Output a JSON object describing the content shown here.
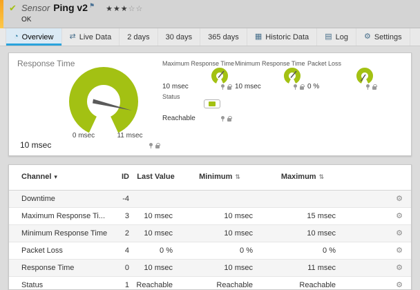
{
  "colors": {
    "accent": "#a3c113",
    "tab_underline": "#2aa3dc",
    "stripe_top": "#f6a320",
    "stripe_bottom": "#fdc84a"
  },
  "header": {
    "check_glyph": "✔",
    "type_label": "Sensor",
    "title": "Ping v2",
    "flag_glyph": "⚑",
    "stars_filled": "★★★",
    "stars_empty": "☆☆",
    "status": "OK"
  },
  "tabs": [
    {
      "label": "Overview",
      "icon": "◔"
    },
    {
      "label": "Live Data",
      "icon": "⇄"
    },
    {
      "label": "2 days"
    },
    {
      "label": "30 days"
    },
    {
      "label": "365 days"
    },
    {
      "label": "Historic Data",
      "icon": "▦"
    },
    {
      "label": "Log",
      "icon": "▤"
    },
    {
      "label": "Settings",
      "icon": "⚙"
    }
  ],
  "gauges": {
    "title": "Response Time",
    "main": {
      "value": "10 msec",
      "min_label": "0 msec",
      "max_label": "11 msec"
    },
    "minis": [
      {
        "title": "Maximum Response Time",
        "value": "10 msec"
      },
      {
        "title": "Minimum Response Time",
        "value": "10 msec"
      },
      {
        "title": "Packet Loss",
        "value": "0 %"
      }
    ],
    "status": {
      "title": "Status",
      "value": "Reachable"
    }
  },
  "table": {
    "columns": [
      "Channel",
      "ID",
      "Last Value",
      "Minimum",
      "Maximum"
    ],
    "sort_caret": "▾",
    "sort_glyph": "⇅",
    "settings_glyph": "⚙",
    "rows": [
      {
        "channel": "Downtime",
        "id": "-4",
        "last": "",
        "min": "",
        "max": ""
      },
      {
        "channel": "Maximum Response Ti...",
        "id": "3",
        "last": "10 msec",
        "min": "10 msec",
        "max": "15 msec"
      },
      {
        "channel": "Minimum Response Time",
        "id": "2",
        "last": "10 msec",
        "min": "10 msec",
        "max": "10 msec"
      },
      {
        "channel": "Packet Loss",
        "id": "4",
        "last": "0 %",
        "min": "0 %",
        "max": "0 %"
      },
      {
        "channel": "Response Time",
        "id": "0",
        "last": "10 msec",
        "min": "10 msec",
        "max": "11 msec"
      },
      {
        "channel": "Status",
        "id": "1",
        "last": "Reachable",
        "min": "Reachable",
        "max": "Reachable"
      }
    ]
  }
}
